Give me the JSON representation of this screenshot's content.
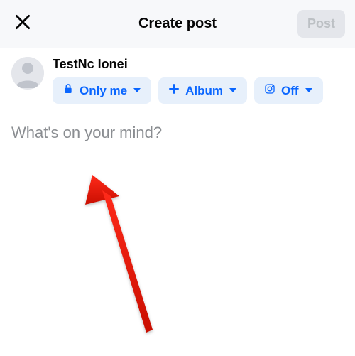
{
  "header": {
    "title": "Create post",
    "post_button": "Post"
  },
  "user": {
    "name": "TestNc Ionei"
  },
  "chips": {
    "privacy": "Only me",
    "album": "Album",
    "instagram": "Off"
  },
  "composer": {
    "placeholder": "What's on your mind?"
  }
}
